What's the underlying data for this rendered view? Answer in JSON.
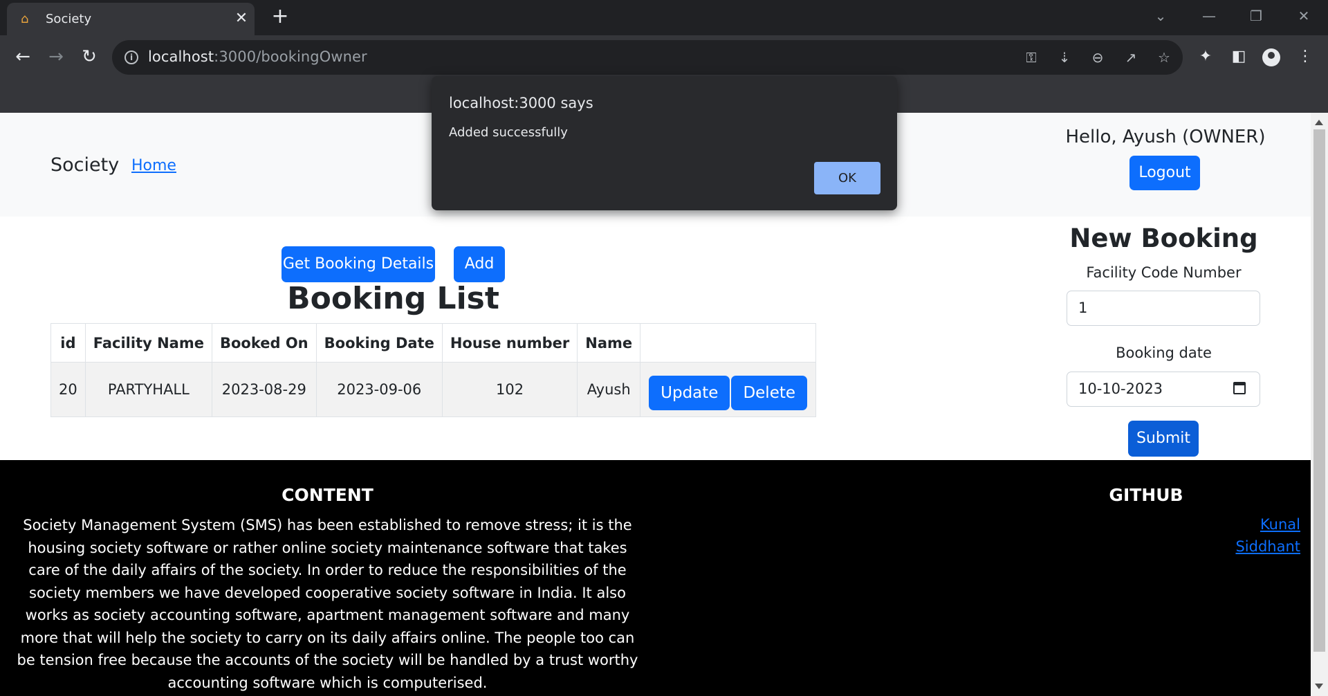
{
  "browser": {
    "tab_title": "Society",
    "url_host": "localhost",
    "url_rest": ":3000/bookingOwner"
  },
  "navbar": {
    "brand": "Society",
    "home_link": "Home",
    "greeting": "Hello, Ayush (OWNER)",
    "logout_label": "Logout"
  },
  "actions": {
    "get_details_label": "Get Booking Details",
    "add_label": "Add"
  },
  "booking_list": {
    "title": "Booking List",
    "columns": [
      "id",
      "Facility Name",
      "Booked On",
      "Booking Date",
      "House number",
      "Name"
    ],
    "rows": [
      {
        "id": "20",
        "facility_name": "PARTYHALL",
        "booked_on": "2023-08-29",
        "booking_date": "2023-09-06",
        "house_number": "102",
        "name": "Ayush",
        "update_label": "Update",
        "delete_label": "Delete"
      }
    ]
  },
  "new_booking": {
    "title": "New Booking",
    "facility_label": "Facility Code Number",
    "facility_value": "1",
    "date_label": "Booking date",
    "date_value": "10-10-2023",
    "submit_label": "Submit"
  },
  "footer": {
    "content_heading": "CONTENT",
    "content_text": "Society Management System (SMS) has been established to remove stress; it is the housing society software or rather online society maintenance software that takes care of the daily affairs of the society. In order to reduce the responsibilities of the society members we have developed cooperative society software in India. It also works as society accounting software, apartment management software and many more that will help the society to carry on its daily affairs online. The people too can be tension free because the accounts of the society will be handled by a trust worthy accounting software which is computerised.",
    "github_heading": "GITHUB",
    "links": [
      "Kunal",
      "Siddhant"
    ]
  },
  "dialog": {
    "title": "localhost:3000 says",
    "message": "Added successfully",
    "ok_label": "OK"
  },
  "colors": {
    "primary": "#0d6efd",
    "chrome_dark": "#35363a",
    "dialog_bg": "#292a2d",
    "dialog_button": "#8ab4f8"
  }
}
